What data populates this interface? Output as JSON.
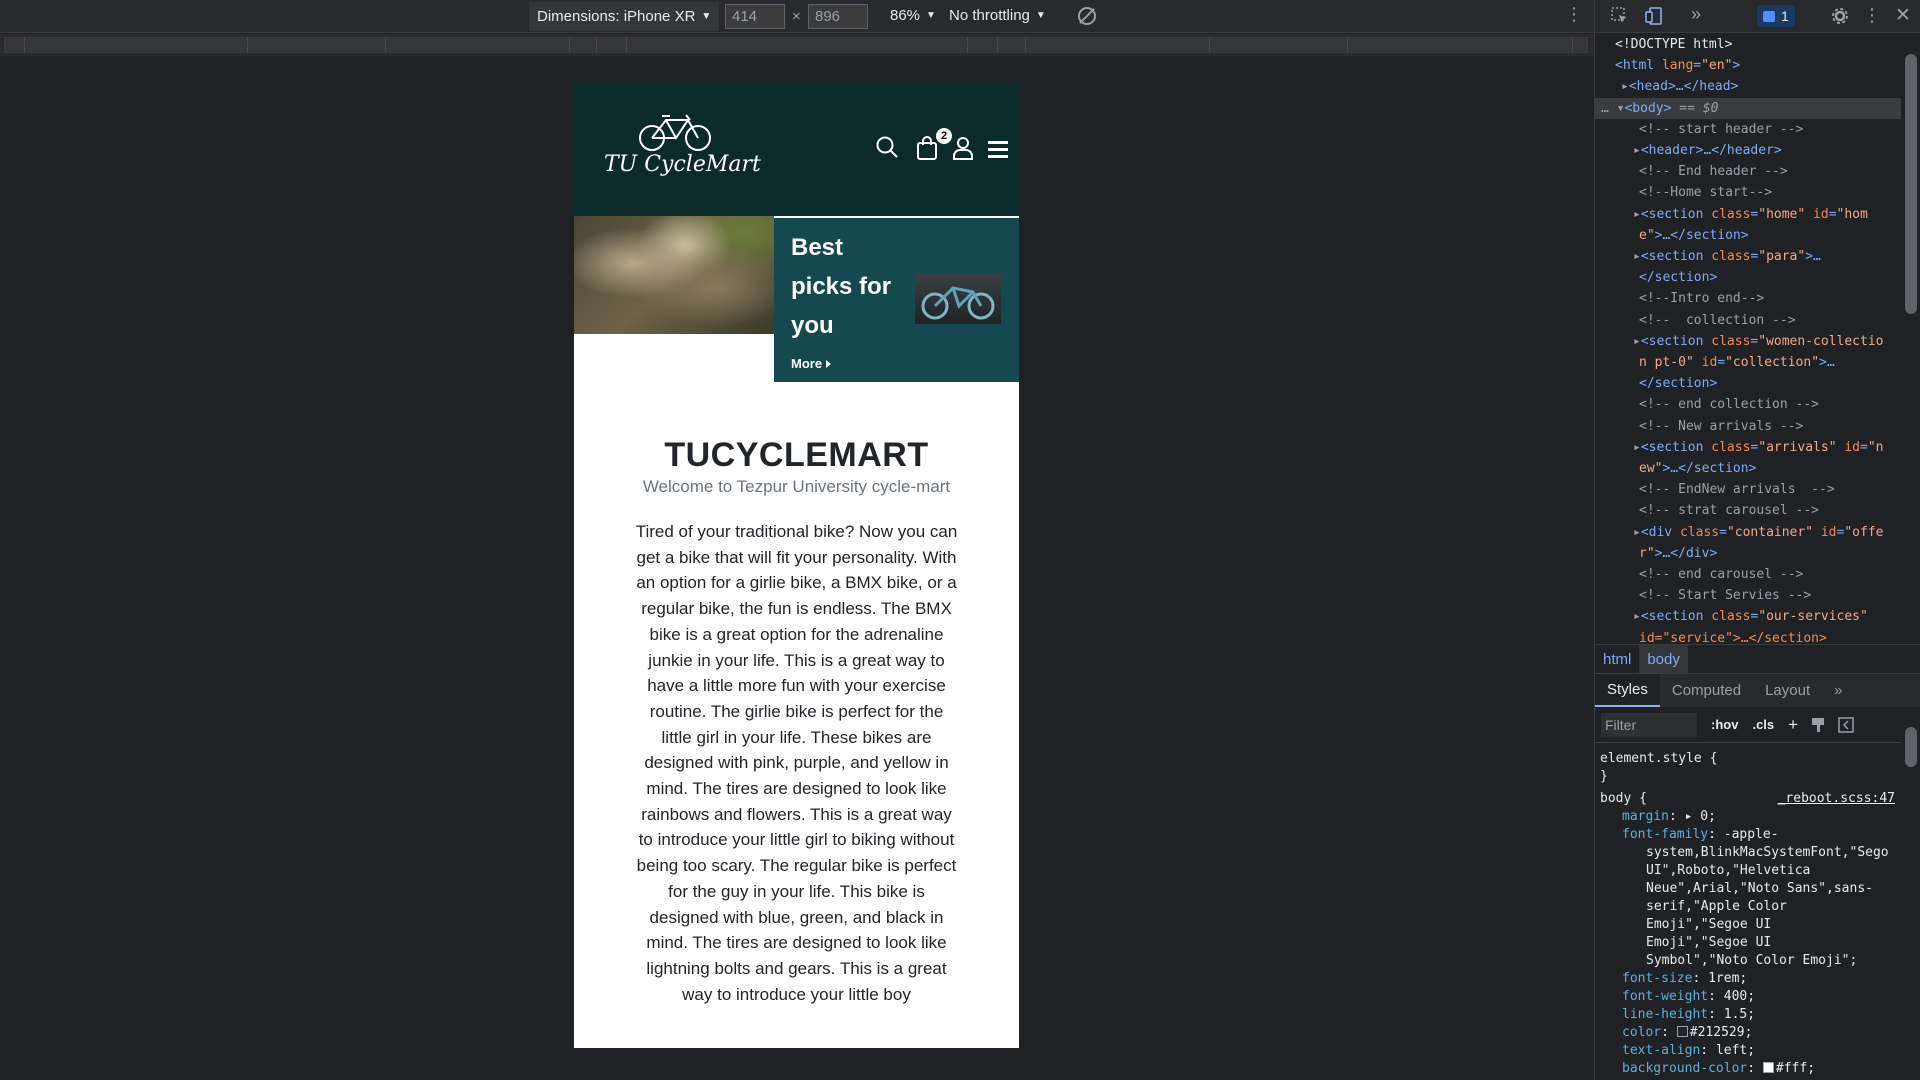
{
  "device_toolbar": {
    "dimensions_label": "Dimensions: iPhone XR",
    "width": "414",
    "x_sep": "×",
    "height": "896",
    "zoom": "86%",
    "throttling": "No throttling"
  },
  "site": {
    "logo_text": "TU CycleMart",
    "cart_count": "2",
    "hero": {
      "title": "Best picks for you",
      "more_label": "More"
    },
    "intro": {
      "title": "TUCYCLEMART",
      "subtitle": "Welcome to Tezpur University cycle-mart",
      "body": "Tired of your traditional bike? Now you can get a bike that will fit your personality. With an option for a girlie bike, a BMX bike, or a regular bike, the fun is endless. The BMX bike is a great option for the adrenaline junkie in your life. This is a great way to have a little more fun with your exercise routine. The girlie bike is perfect for the little girl in your life. These bikes are designed with pink, purple, and yellow in mind. The tires are designed to look like rainbows and flowers. This is a great way to introduce your little girl to biking without being too scary. The regular bike is perfect for the guy in your life. This bike is designed with blue, green, and black in mind. The tires are designed to look like lightning bolts and gears. This is a great way to introduce your little boy"
    }
  },
  "devtools": {
    "issues_count": "1",
    "dom": {
      "doctype": "<!DOCTYPE html>",
      "html_open": "<html",
      "html_lang_attr": "lang",
      "html_lang_val": "\"en\"",
      "head": "<head>…</head>",
      "body": "<body>",
      "body_marker": " == $0",
      "c_start_header": "<!-- start header -->",
      "header": "<header>…</header>",
      "c_end_header": "<!-- End header -->",
      "c_home_start": "<!--Home start-->",
      "home_section_1": "<section",
      "home_class_attr": "class",
      "home_class_val": "\"home\"",
      "home_id_attr": "id",
      "home_id_val_1": "\"hom",
      "home_id_val_2": "e\"",
      "home_close": ">…</section>",
      "para_section": "<section",
      "para_class_attr": "class",
      "para_class_val": "\"para\"",
      "para_open_end": ">…",
      "para_close": "</section>",
      "c_intro_end": "<!--Intro end-->",
      "c_collection": "<!--  collection -->",
      "women_section": "<section",
      "women_class_attr": "class",
      "women_class_val_1": "\"women-collectio",
      "women_class_val_2": "n pt-0\"",
      "women_id_attr": "id",
      "women_id_val": "\"collection\"",
      "women_open_end": ">…",
      "women_close": "</section>",
      "c_end_collection": "<!-- end collection -->",
      "c_new_arrivals": "<!-- New arrivals -->",
      "arrivals_section": "<section",
      "arrivals_class_attr": "class",
      "arrivals_class_val": "\"arrivals\"",
      "arrivals_id_attr": "id",
      "arrivals_id_val_1": "\"n",
      "arrivals_id_val_2": "ew\"",
      "arrivals_close": ">…</section>",
      "c_endnew_arrivals": "<!-- EndNew arrivals  -->",
      "c_strat_carousel": "<!-- strat carousel -->",
      "div_open": "<div",
      "div_class_attr": "class",
      "div_class_val": "\"container\"",
      "div_id_attr": "id",
      "div_id_val_1": "\"offe",
      "div_id_val_2": "r\"",
      "div_close": ">…</div>",
      "c_end_carousel": "<!-- end carousel -->",
      "c_start_servies": "<!-- Start Servies -->",
      "services_section": "<section",
      "services_class_attr": "class",
      "services_class_val": "\"our-services\"",
      "services_cut": "id=\"service\">…</section>"
    },
    "breadcrumbs": [
      "html",
      "body"
    ],
    "tabs": [
      "Styles",
      "Computed",
      "Layout"
    ],
    "filter_placeholder": "Filter",
    "hov_label": ":hov",
    "cls_label": ".cls",
    "styles": {
      "element_style": "element.style {",
      "close_brace": "}",
      "body_selector": "body {",
      "source": "_reboot.scss:47",
      "margin_name": "margin",
      "margin_val": "▸ 0;",
      "font_family_name": "font-family",
      "font_family_lines": [
        "-apple-",
        "system,BlinkMacSystemFont,\"Sego",
        "UI\",Roboto,\"Helvetica",
        "Neue\",Arial,\"Noto Sans\",sans-",
        "serif,\"Apple Color",
        "Emoji\",\"Segoe UI",
        "Emoji\",\"Segoe UI",
        "Symbol\",\"Noto Color Emoji\";"
      ],
      "font_size_name": "font-size",
      "font_size_val": "1rem;",
      "font_weight_name": "font-weight",
      "font_weight_val": "400;",
      "line_height_name": "line-height",
      "line_height_val": "1.5;",
      "color_name": "color",
      "color_val": "#212529;",
      "text_align_name": "text-align",
      "text_align_val": "left;",
      "bg_name": "background-color",
      "bg_val": "#fff;"
    }
  },
  "colors": {
    "site_header_bg": "#0b2b2b",
    "hero_card_bg": "#16494f",
    "devtools_bg": "#202124",
    "accent_blue": "#8ab4f8"
  }
}
